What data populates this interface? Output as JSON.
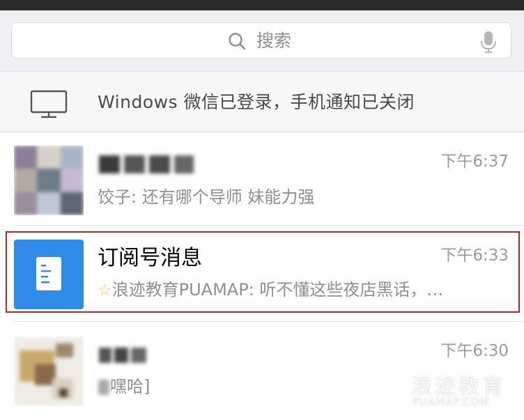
{
  "search": {
    "placeholder": "搜索"
  },
  "notice": {
    "text": "Windows 微信已登录，手机通知已关闭"
  },
  "chats": [
    {
      "time": "下午6:37",
      "preview": "饺子: 还有哪个导师  妹能力强"
    },
    {
      "title": "订阅号消息",
      "time": "下午6:33",
      "preview": "浪迹教育PUAMAP: 听不懂这些夜店黑话，…"
    },
    {
      "time": "下午6:30",
      "preview": "嘿哈]"
    }
  ],
  "watermark": {
    "text": "浪迹教育",
    "sub": "PUAMAP.COM"
  },
  "colors": {
    "accent": "#2f8be8",
    "highlight": "#b32630",
    "star": "#f6c344"
  },
  "icons": [
    "search-icon",
    "mic-icon",
    "monitor-icon",
    "document-icon",
    "star-icon"
  ]
}
